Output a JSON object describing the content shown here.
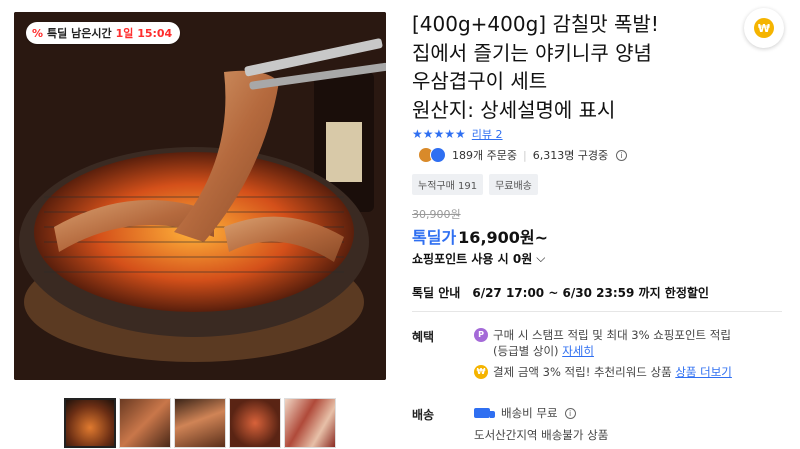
{
  "product": {
    "badge": {
      "prefix": "특딜 남은시간",
      "time": "1일 15:04",
      "icon": "percent-icon"
    },
    "title_lines": [
      "[400g+400g] 감칠맛 폭발!",
      "집에서 즐기는 야키니쿠 양념",
      "우삼겹구이 세트",
      "원산지: 상세설명에 표시"
    ],
    "rating": {
      "stars": 4.5,
      "review_label": "리뷰 2"
    },
    "stats": {
      "orders": "189개 주문중",
      "watching": "6,313명 구경중"
    },
    "tags": [
      "누적구매 191",
      "무료배송"
    ],
    "original_price": "30,900원",
    "price": {
      "label": "톡딜가",
      "value": "16,900원~"
    },
    "points": "쇼핑포인트 사용 시 0원",
    "deal_info": {
      "label": "톡딜 안내",
      "value": "6/27 17:00 ~ 6/30 23:59 까지 한정할인"
    },
    "benefits": {
      "label": "혜택",
      "items": [
        {
          "icon": "point-icon",
          "text": "구매 시 스탬프 적립 및 최대 3% 쇼핑포인트 적립",
          "subtext": "(등급별 상이)",
          "link": "자세히"
        },
        {
          "icon": "coin-icon",
          "text": "결제 금액 3% 적립! 추천리워드 상품",
          "link": "상품 더보기"
        }
      ]
    },
    "shipping": {
      "label": "배송",
      "fee": "배송비 무료",
      "note": "도서산간지역 배송불가 상품"
    },
    "thumbnails": 5
  },
  "colors": {
    "accent": "#2f6ff1",
    "deal": "#ff2d2d"
  }
}
